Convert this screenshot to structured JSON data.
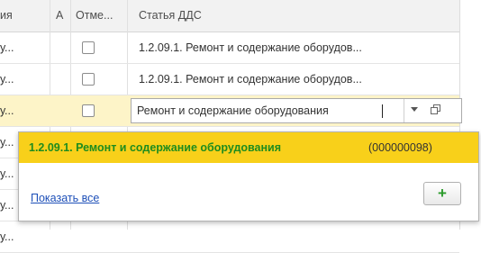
{
  "columns": [
    "ия",
    "А",
    "Отме...",
    "Статья ДДС"
  ],
  "rows": [
    {
      "left": "у...",
      "article": "1.2.09.1. Ремонт и содержание оборудов..."
    },
    {
      "left": "у...",
      "article": "1.2.09.1. Ремонт и содержание оборудов..."
    },
    {
      "left": "у..."
    },
    {
      "left": "у..."
    },
    {
      "left": "у..."
    },
    {
      "left": "у..."
    },
    {
      "left": "у..."
    }
  ],
  "editor": {
    "value": "Ремонт и содержание оборудования",
    "dropdown_icon": "triangle-down-icon",
    "open_icon": "open-window-icon"
  },
  "popup": {
    "item_name": "1.2.09.1. Ремонт и содержание оборудования",
    "item_code": "(000000098)",
    "show_all": "Показать все",
    "add_icon": "plus-icon",
    "add_label": "+"
  },
  "colors": {
    "highlight": "#f8d01a",
    "item_text": "#1e8c1e",
    "link": "#1d4fb8",
    "add_plus": "#2a9a2a"
  }
}
